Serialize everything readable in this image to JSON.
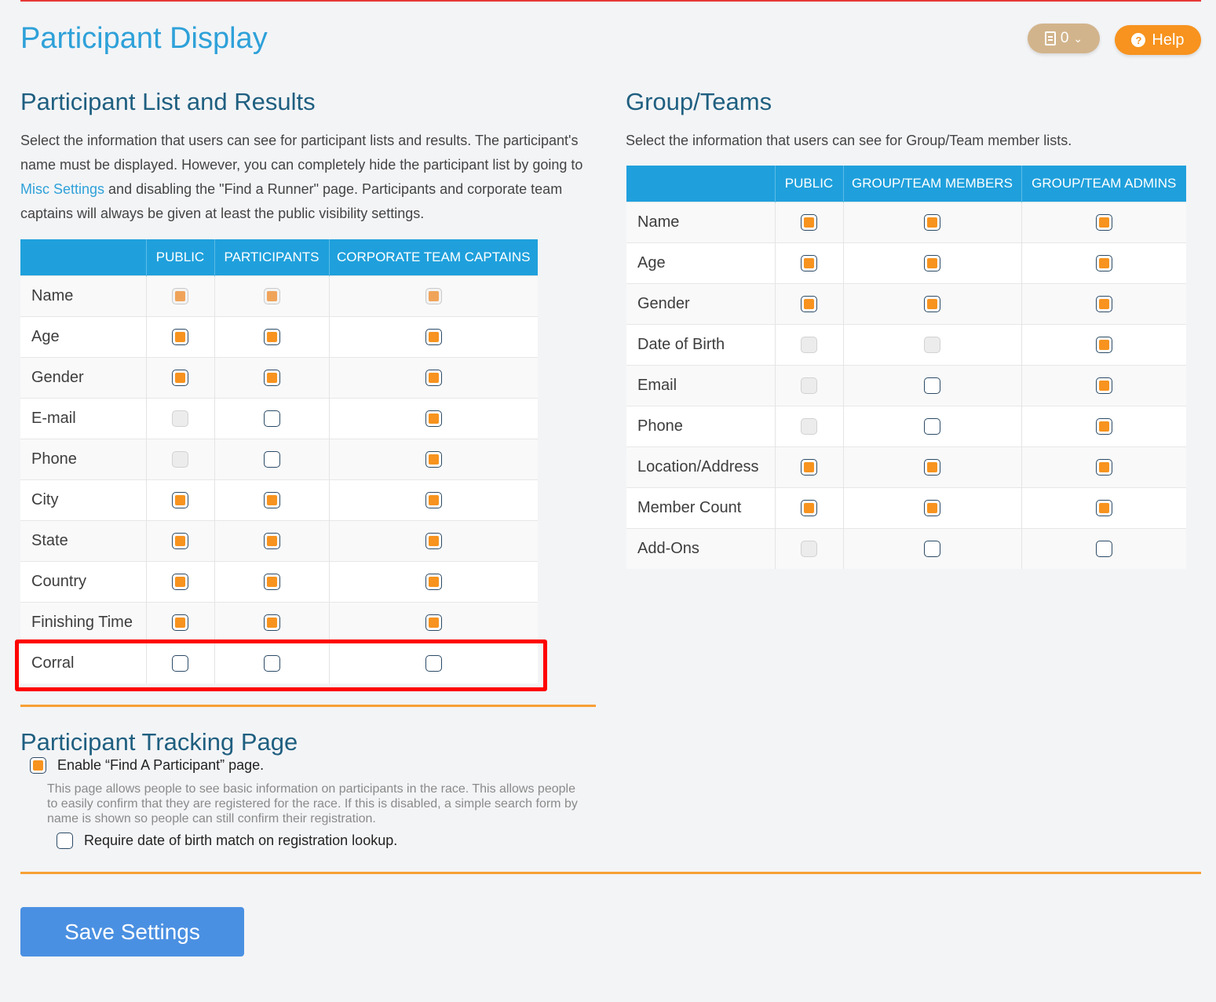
{
  "page_title": "Participant Display",
  "header": {
    "notes_count": "0",
    "notes_icon": "document-icon",
    "help_label": "Help",
    "help_icon": "question-circle-icon"
  },
  "participant_list": {
    "title": "Participant List and Results",
    "desc_part1": "Select the information that users can see for participant lists and results. The participant's name must be displayed. However, you can completely hide the participant list by going to ",
    "desc_link": "Misc Settings",
    "desc_part2": " and disabling the \"Find a Runner\" page. Participants and corporate team captains will always be given at least the public visibility settings.",
    "columns": [
      "PUBLIC",
      "PARTICIPANTS",
      "CORPORATE TEAM CAPTAINS"
    ],
    "rows": [
      {
        "label": "Name",
        "cells": [
          {
            "checked": true,
            "disabled": true
          },
          {
            "checked": true,
            "disabled": true
          },
          {
            "checked": true,
            "disabled": true
          }
        ]
      },
      {
        "label": "Age",
        "cells": [
          {
            "checked": true,
            "disabled": false
          },
          {
            "checked": true,
            "disabled": false
          },
          {
            "checked": true,
            "disabled": false
          }
        ]
      },
      {
        "label": "Gender",
        "cells": [
          {
            "checked": true,
            "disabled": false
          },
          {
            "checked": true,
            "disabled": false
          },
          {
            "checked": true,
            "disabled": false
          }
        ]
      },
      {
        "label": "E-mail",
        "cells": [
          {
            "checked": false,
            "disabled": true
          },
          {
            "checked": false,
            "disabled": false
          },
          {
            "checked": true,
            "disabled": false
          }
        ]
      },
      {
        "label": "Phone",
        "cells": [
          {
            "checked": false,
            "disabled": true
          },
          {
            "checked": false,
            "disabled": false
          },
          {
            "checked": true,
            "disabled": false
          }
        ]
      },
      {
        "label": "City",
        "cells": [
          {
            "checked": true,
            "disabled": false
          },
          {
            "checked": true,
            "disabled": false
          },
          {
            "checked": true,
            "disabled": false
          }
        ]
      },
      {
        "label": "State",
        "cells": [
          {
            "checked": true,
            "disabled": false
          },
          {
            "checked": true,
            "disabled": false
          },
          {
            "checked": true,
            "disabled": false
          }
        ]
      },
      {
        "label": "Country",
        "cells": [
          {
            "checked": true,
            "disabled": false
          },
          {
            "checked": true,
            "disabled": false
          },
          {
            "checked": true,
            "disabled": false
          }
        ]
      },
      {
        "label": "Finishing Time",
        "cells": [
          {
            "checked": true,
            "disabled": false
          },
          {
            "checked": true,
            "disabled": false
          },
          {
            "checked": true,
            "disabled": false
          }
        ]
      },
      {
        "label": "Corral",
        "cells": [
          {
            "checked": false,
            "disabled": false
          },
          {
            "checked": false,
            "disabled": false
          },
          {
            "checked": false,
            "disabled": false
          }
        ]
      }
    ]
  },
  "group_teams": {
    "title": "Group/Teams",
    "desc": "Select the information that users can see for Group/Team member lists.",
    "columns": [
      "PUBLIC",
      "GROUP/TEAM MEMBERS",
      "GROUP/TEAM ADMINS"
    ],
    "rows": [
      {
        "label": "Name",
        "cells": [
          {
            "checked": true,
            "disabled": false
          },
          {
            "checked": true,
            "disabled": false
          },
          {
            "checked": true,
            "disabled": false
          }
        ]
      },
      {
        "label": "Age",
        "cells": [
          {
            "checked": true,
            "disabled": false
          },
          {
            "checked": true,
            "disabled": false
          },
          {
            "checked": true,
            "disabled": false
          }
        ]
      },
      {
        "label": "Gender",
        "cells": [
          {
            "checked": true,
            "disabled": false
          },
          {
            "checked": true,
            "disabled": false
          },
          {
            "checked": true,
            "disabled": false
          }
        ]
      },
      {
        "label": "Date of Birth",
        "cells": [
          {
            "checked": false,
            "disabled": true
          },
          {
            "checked": false,
            "disabled": true
          },
          {
            "checked": true,
            "disabled": false
          }
        ]
      },
      {
        "label": "Email",
        "cells": [
          {
            "checked": false,
            "disabled": true
          },
          {
            "checked": false,
            "disabled": false
          },
          {
            "checked": true,
            "disabled": false
          }
        ]
      },
      {
        "label": "Phone",
        "cells": [
          {
            "checked": false,
            "disabled": true
          },
          {
            "checked": false,
            "disabled": false
          },
          {
            "checked": true,
            "disabled": false
          }
        ]
      },
      {
        "label": "Location/Address",
        "cells": [
          {
            "checked": true,
            "disabled": false
          },
          {
            "checked": true,
            "disabled": false
          },
          {
            "checked": true,
            "disabled": false
          }
        ]
      },
      {
        "label": "Member Count",
        "cells": [
          {
            "checked": true,
            "disabled": false
          },
          {
            "checked": true,
            "disabled": false
          },
          {
            "checked": true,
            "disabled": false
          }
        ]
      },
      {
        "label": "Add-Ons",
        "cells": [
          {
            "checked": false,
            "disabled": true
          },
          {
            "checked": false,
            "disabled": false
          },
          {
            "checked": false,
            "disabled": false
          }
        ]
      }
    ]
  },
  "tracking": {
    "title": "Participant Tracking Page",
    "enable_label": "Enable “Find A Participant” page.",
    "enable_checked": true,
    "help_text": "This page allows people to see basic information on participants in the race. This allows people to easily confirm that they are registered for the race. If this is disabled, a simple search form by name is shown so people can still confirm their registration.",
    "dob_label": "Require date of birth match on registration lookup.",
    "dob_checked": false
  },
  "save_label": "Save Settings",
  "colors": {
    "accent_blue": "#1fa0dc",
    "title_blue": "#2ea1d9",
    "orange": "#f7931e",
    "highlight_red": "#ff0000",
    "save_blue": "#4a90e2"
  }
}
